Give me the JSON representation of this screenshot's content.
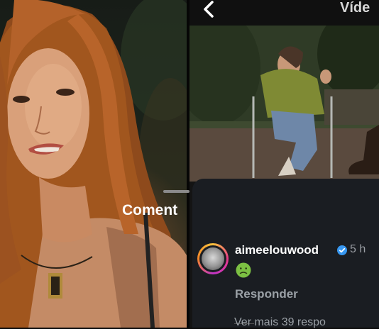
{
  "header": {
    "title": "Víde",
    "back_icon": "chevron-left-icon"
  },
  "comments_sheet": {
    "title": "Coment"
  },
  "comment": {
    "username": "aimeelouwood",
    "verified_icon": "verified-badge-icon",
    "time": "5 h",
    "emoji_icon": "nauseated-face-icon",
    "reply_label": "Responder",
    "more_replies": "Ver mais 39 respo"
  },
  "colors": {
    "verified": "#3797f0",
    "emoji": "#7cc043",
    "sheet_bg": "#1a1d22"
  }
}
